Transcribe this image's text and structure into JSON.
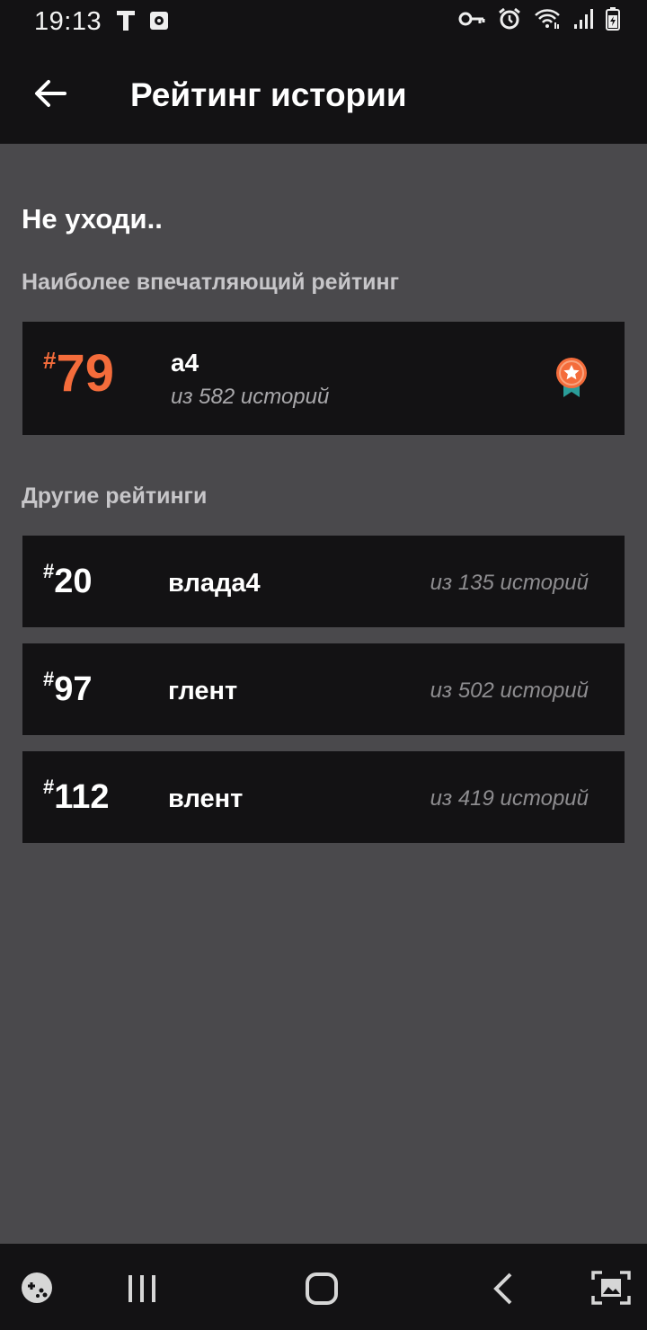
{
  "status_bar": {
    "time": "19:13",
    "left_icons": [
      "t-app-icon",
      "photo-app-icon"
    ],
    "right_icons": [
      "vpn-key-icon",
      "alarm-icon",
      "wifi-icon",
      "signal-icon",
      "battery-icon"
    ]
  },
  "app_bar": {
    "title": "Рейтинг истории",
    "back_icon": "arrow-left-icon"
  },
  "main": {
    "heading": "Не уходи..",
    "best_label": "Наиболее впечатляющий рейтинг",
    "best": {
      "hash": "#",
      "rank": "79",
      "name": "а4",
      "count": "из 582 историй",
      "badge_icon": "star-medal-icon"
    },
    "others_label": "Другие рейтинги",
    "others": [
      {
        "hash": "#",
        "rank": "20",
        "name": "влада4",
        "count": "из 135 историй"
      },
      {
        "hash": "#",
        "rank": "97",
        "name": "глент",
        "count": "из 502 историй"
      },
      {
        "hash": "#",
        "rank": "112",
        "name": "влент",
        "count": "из 419 историй"
      }
    ]
  },
  "nav_bar": {
    "items": [
      "game-launcher-icon",
      "recent-apps-icon",
      "home-icon",
      "back-icon",
      "screenshot-icon"
    ]
  },
  "colors": {
    "accent": "#f46c3b",
    "medal_ribbon": "#2a9d99",
    "background": "#4a494c",
    "card": "#131214"
  }
}
